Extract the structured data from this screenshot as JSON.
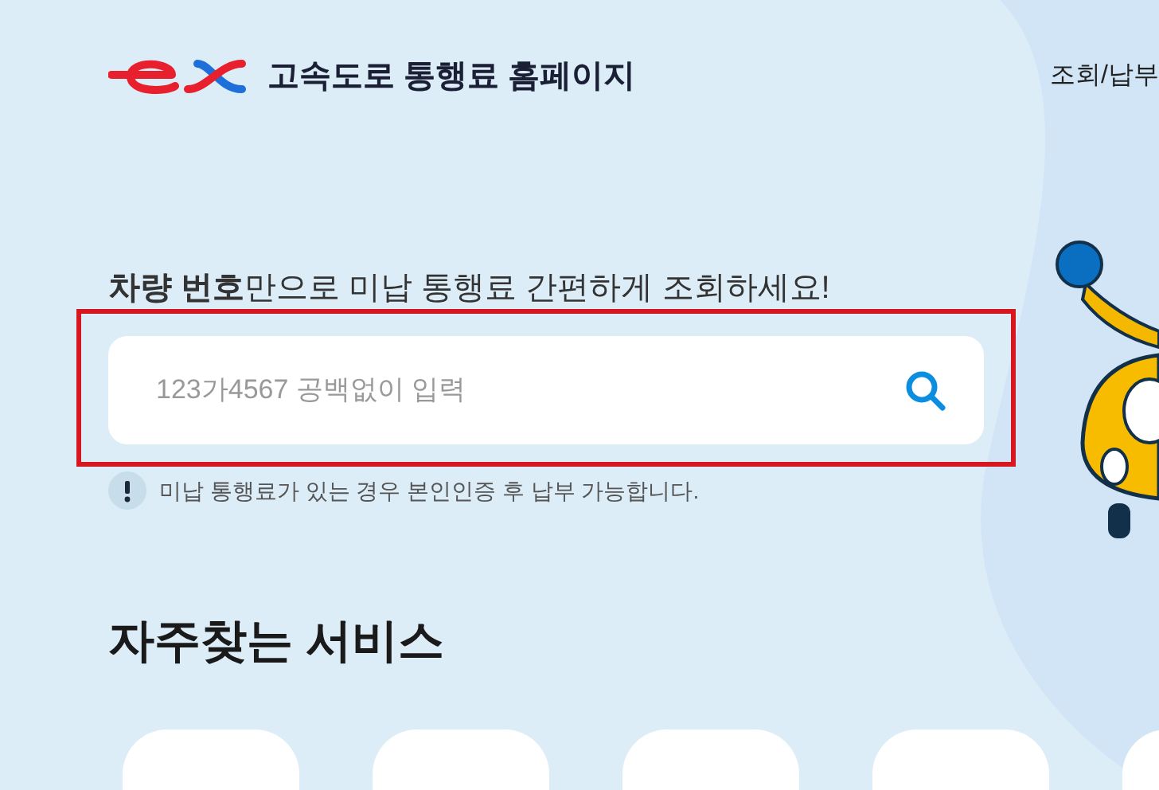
{
  "header": {
    "title": "고속도로 통행료 홈페이지",
    "nav": [
      "조회/납부"
    ]
  },
  "search": {
    "headline": "**차량 번호**만으로 미납 통행료 간편하게 조회하세요!",
    "placeholder": "123가4567 공백없이 입력",
    "notice": "미납 통행료가 있는 경우 본인인증 후 납부 가능합니다."
  },
  "services": {
    "title": "자주찾는 서비스"
  }
}
